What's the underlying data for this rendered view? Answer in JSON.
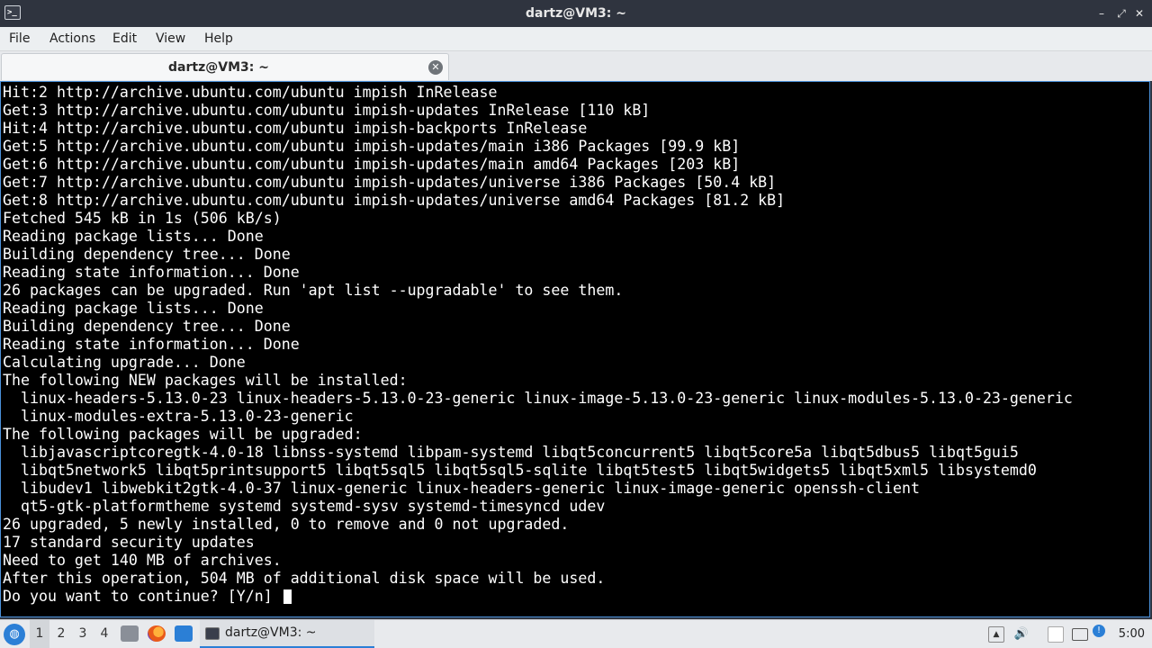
{
  "window": {
    "title": "dartz@VM3: ~",
    "icon_glyph": ">_"
  },
  "window_controls": {
    "minimize": "–",
    "maximize": "⤢",
    "close": "✕"
  },
  "menu": [
    "File",
    "Actions",
    "Edit",
    "View",
    "Help"
  ],
  "tab": {
    "label": "dartz@VM3: ~",
    "close_glyph": "✕"
  },
  "terminal_lines": [
    "Hit:2 http://archive.ubuntu.com/ubuntu impish InRelease",
    "Get:3 http://archive.ubuntu.com/ubuntu impish-updates InRelease [110 kB]",
    "Hit:4 http://archive.ubuntu.com/ubuntu impish-backports InRelease",
    "Get:5 http://archive.ubuntu.com/ubuntu impish-updates/main i386 Packages [99.9 kB]",
    "Get:6 http://archive.ubuntu.com/ubuntu impish-updates/main amd64 Packages [203 kB]",
    "Get:7 http://archive.ubuntu.com/ubuntu impish-updates/universe i386 Packages [50.4 kB]",
    "Get:8 http://archive.ubuntu.com/ubuntu impish-updates/universe amd64 Packages [81.2 kB]",
    "Fetched 545 kB in 1s (506 kB/s)",
    "Reading package lists... Done",
    "Building dependency tree... Done",
    "Reading state information... Done",
    "26 packages can be upgraded. Run 'apt list --upgradable' to see them.",
    "Reading package lists... Done",
    "Building dependency tree... Done",
    "Reading state information... Done",
    "Calculating upgrade... Done",
    "The following NEW packages will be installed:",
    "  linux-headers-5.13.0-23 linux-headers-5.13.0-23-generic linux-image-5.13.0-23-generic linux-modules-5.13.0-23-generic",
    "  linux-modules-extra-5.13.0-23-generic",
    "The following packages will be upgraded:",
    "  libjavascriptcoregtk-4.0-18 libnss-systemd libpam-systemd libqt5concurrent5 libqt5core5a libqt5dbus5 libqt5gui5",
    "  libqt5network5 libqt5printsupport5 libqt5sql5 libqt5sql5-sqlite libqt5test5 libqt5widgets5 libqt5xml5 libsystemd0",
    "  libudev1 libwebkit2gtk-4.0-37 linux-generic linux-headers-generic linux-image-generic openssh-client",
    "  qt5-gtk-platformtheme systemd systemd-sysv systemd-timesyncd udev",
    "26 upgraded, 5 newly installed, 0 to remove and 0 not upgraded.",
    "17 standard security updates",
    "Need to get 140 MB of archives.",
    "After this operation, 504 MB of additional disk space will be used."
  ],
  "prompt_line": "Do you want to continue? [Y/n] ",
  "taskbar": {
    "start_glyph": "◍",
    "workspaces": [
      "1",
      "2",
      "3",
      "4"
    ],
    "active_workspace": "1",
    "task_label": "dartz@VM3: ~",
    "clock": "5:00",
    "tray_glyphs": {
      "up": "▲",
      "volume": "🔊",
      "notify": "!"
    }
  },
  "colors": {
    "terminal_bg": "#000000",
    "terminal_fg": "#ffffff",
    "accent": "#2b7fd6"
  }
}
